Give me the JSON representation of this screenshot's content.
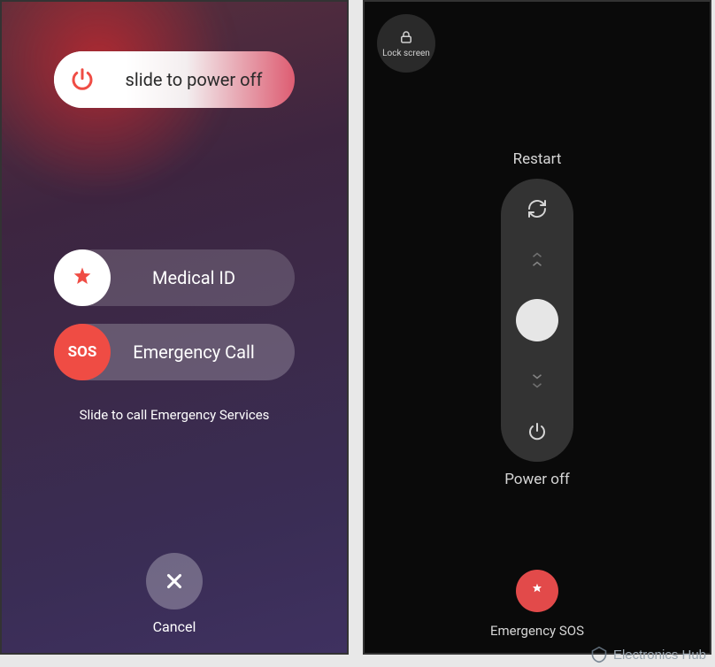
{
  "ios": {
    "power_slider_label": "slide to power off",
    "medical_label": "Medical ID",
    "emergency_label": "Emergency Call",
    "sos_knob_text": "SOS",
    "subtext": "Slide to call Emergency Services",
    "cancel_label": "Cancel"
  },
  "android": {
    "lock_label": "Lock screen",
    "restart_label": "Restart",
    "poweroff_label": "Power off",
    "sos_label": "Emergency SOS"
  },
  "watermark": {
    "text": "Electronics Hub"
  },
  "colors": {
    "ios_sos_knob": "#ef4c44",
    "android_sos": "#e24a4a",
    "android_pill": "#333333"
  }
}
